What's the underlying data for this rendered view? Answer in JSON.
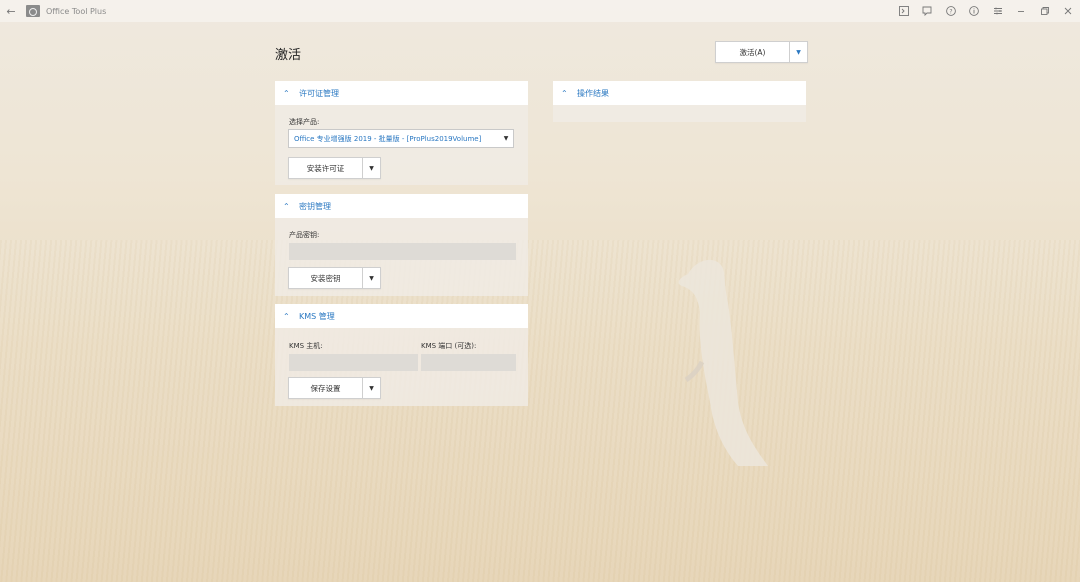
{
  "window": {
    "title": "Office Tool Plus",
    "back_icon": "back-arrow-icon",
    "controls": [
      "console-icon",
      "feedback-icon",
      "help-icon",
      "info-icon",
      "settings-icon",
      "minimize-icon",
      "restore-icon",
      "close-icon"
    ]
  },
  "page": {
    "title": "激活",
    "activate_button": "激活(A)"
  },
  "license": {
    "header": "许可证管理",
    "select_label": "选择产品:",
    "selected_product": "Office 专业增强版 2019 - 批量版 - [ProPlus2019Volume]",
    "install_button": "安装许可证"
  },
  "keys": {
    "header": "密钥管理",
    "product_key_label": "产品密钥:",
    "product_key_value": "",
    "install_button": "安装密钥"
  },
  "kms": {
    "header": "KMS 管理",
    "host_label": "KMS 主机:",
    "port_label": "KMS 端口 (可选):",
    "host_value": "",
    "port_value": "",
    "save_button": "保存设置"
  },
  "result": {
    "header": "操作结果"
  },
  "colors": {
    "accent": "#2a78c2"
  }
}
